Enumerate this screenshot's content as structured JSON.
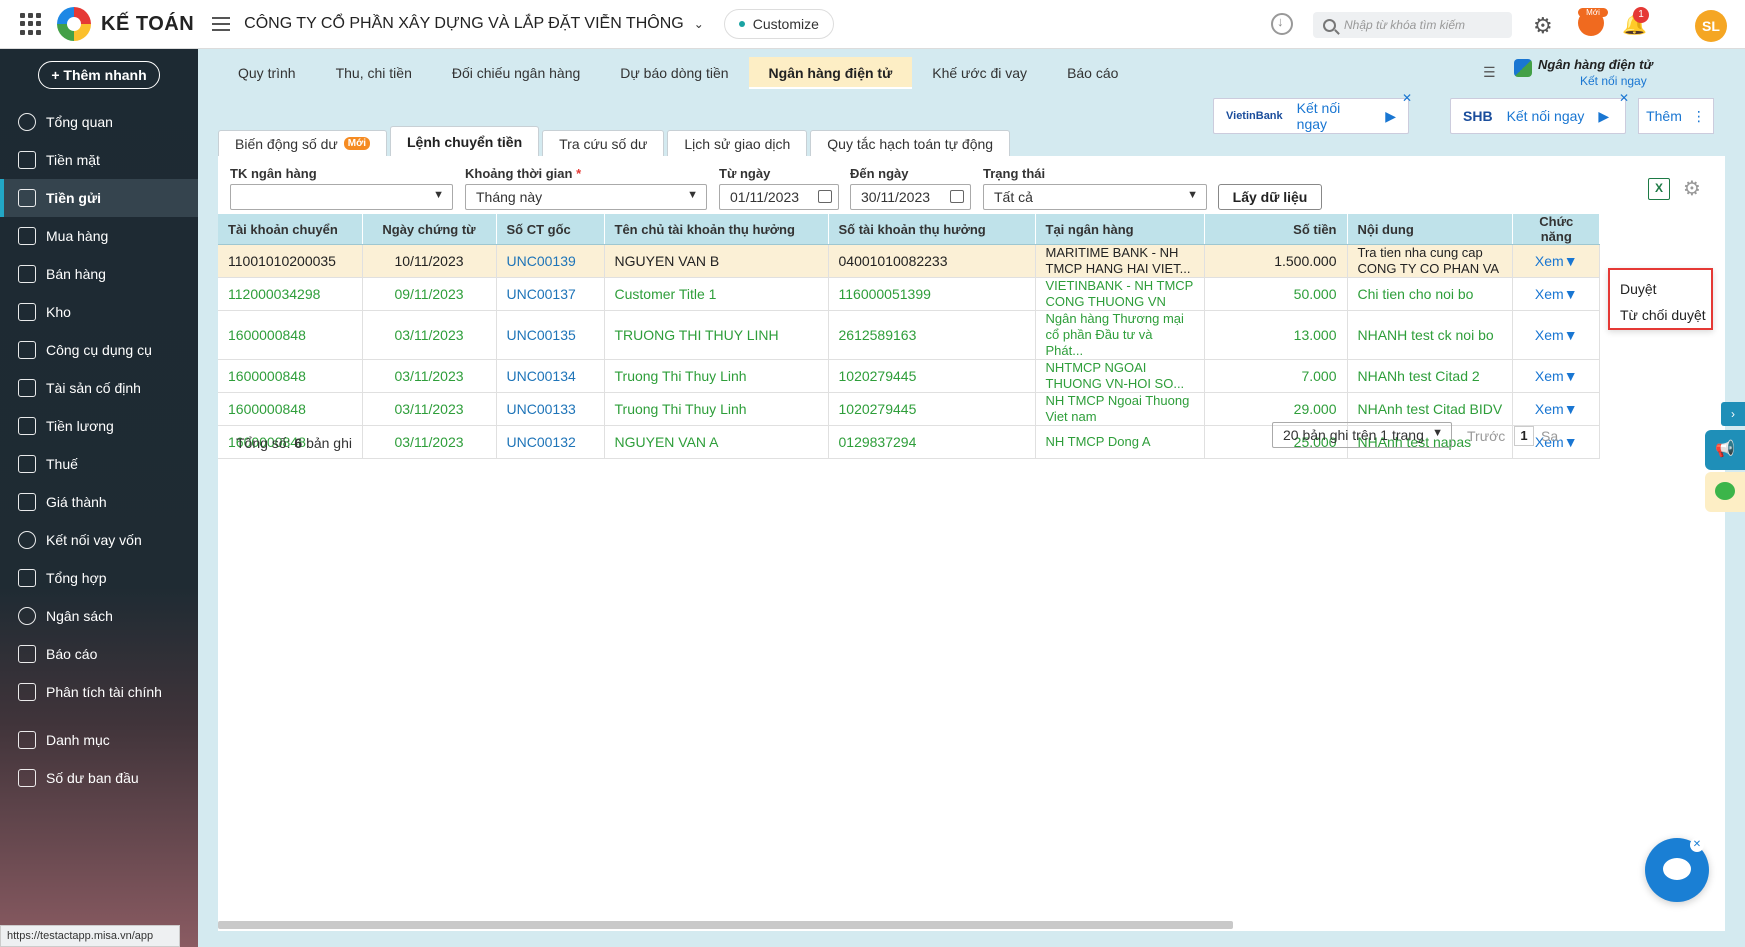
{
  "header": {
    "brand": "KẾ TOÁN",
    "company": "CÔNG TY CỔ PHẦN XÂY DỰNG VÀ LẮP ĐẶT VIỄN THÔNG",
    "customize": "Customize",
    "search_placeholder": "Nhập từ khóa tìm kiếm",
    "new_badge": "Mới",
    "notif_count": "1",
    "avatar": "SL"
  },
  "sidebar": {
    "add_button": "+ Thêm nhanh",
    "items": [
      {
        "label": "Tổng quan",
        "icon": "dashboard-icon"
      },
      {
        "label": "Tiền mặt",
        "icon": "cash-icon"
      },
      {
        "label": "Tiền gửi",
        "icon": "bank-deposit-icon",
        "active": true
      },
      {
        "label": "Mua hàng",
        "icon": "shopping-bag-icon"
      },
      {
        "label": "Bán hàng",
        "icon": "cart-icon"
      },
      {
        "label": "Kho",
        "icon": "warehouse-icon"
      },
      {
        "label": "Công cụ dụng cụ",
        "icon": "tools-icon"
      },
      {
        "label": "Tài sản cố định",
        "icon": "asset-icon"
      },
      {
        "label": "Tiền lương",
        "icon": "salary-icon"
      },
      {
        "label": "Thuế",
        "icon": "tax-icon"
      },
      {
        "label": "Giá thành",
        "icon": "price-tag-icon"
      },
      {
        "label": "Kết nối vay vốn",
        "icon": "loan-icon"
      },
      {
        "label": "Tổng hợp",
        "icon": "summary-icon"
      },
      {
        "label": "Ngân sách",
        "icon": "budget-icon"
      },
      {
        "label": "Báo cáo",
        "icon": "report-icon"
      },
      {
        "label": "Phân tích tài chính",
        "icon": "analytics-icon"
      },
      {
        "label": "Danh mục",
        "icon": "list-icon"
      },
      {
        "label": "Số dư ban đầu",
        "icon": "opening-balance-icon"
      }
    ],
    "status_url": "https://testactapp.misa.vn/app"
  },
  "main_tabs": [
    "Quy trình",
    "Thu, chi tiền",
    "Đối chiếu ngân hàng",
    "Dự báo dòng tiền",
    "Ngân hàng điện tử",
    "Khế ước đi vay",
    "Báo cáo"
  ],
  "ebank": {
    "title": "Ngân hàng điện tử",
    "link": "Kết nối ngay"
  },
  "bank_cards": [
    {
      "name": "VietinBank",
      "action": "Kết nối ngay"
    },
    {
      "name": "SHB",
      "action": "Kết nối ngay"
    }
  ],
  "more_label": "Thêm",
  "sub_tabs": [
    {
      "label": "Biến động số dư",
      "badge": "Mới"
    },
    {
      "label": "Lệnh chuyển tiền",
      "active": true
    },
    {
      "label": "Tra cứu số dư"
    },
    {
      "label": "Lịch sử giao dịch"
    },
    {
      "label": "Quy tắc hạch toán tự động"
    }
  ],
  "filters": {
    "account_label": "TK ngân hàng",
    "account_value": "",
    "period_label": "Khoảng thời gian",
    "period_value": "Tháng này",
    "from_label": "Từ ngày",
    "from_value": "01/11/2023",
    "to_label": "Đến ngày",
    "to_value": "30/11/2023",
    "status_label": "Trạng thái",
    "status_value": "Tất cả",
    "get_button": "Lấy dữ liệu"
  },
  "table": {
    "columns": [
      "Tài khoản chuyển",
      "Ngày chứng từ",
      "Số CT gốc",
      "Tên chủ tài khoản thụ hưởng",
      "Số tài khoản thụ hưởng",
      "Tại ngân hàng",
      "Số tiền",
      "Nội dung",
      "Chức năng"
    ],
    "rows": [
      {
        "from": "11001010200035",
        "date": "10/11/2023",
        "ref": "UNC00139",
        "name": "NGUYEN VAN B",
        "to": "04001010082233",
        "bank": "MARITIME BANK - NH TMCP HANG HAI VIET...",
        "amount": "1.500.000",
        "content": "Tra tien nha cung cap CONG TY CO PHAN VA",
        "action": "Xem",
        "selected": true
      },
      {
        "from": "112000034298",
        "date": "09/11/2023",
        "ref": "UNC00137",
        "name": "Customer Title 1",
        "to": "116000051399",
        "bank": "VIETINBANK - NH TMCP CONG THUONG VN",
        "amount": "50.000",
        "content": "Chi tien cho noi bo",
        "action": "Xem"
      },
      {
        "from": "1600000848",
        "date": "03/11/2023",
        "ref": "UNC00135",
        "name": "TRUONG THI THUY LINH",
        "to": "2612589163",
        "bank": "Ngân hàng Thương mại cổ phần Đầu tư và Phát...",
        "amount": "13.000",
        "content": "NHANH test ck noi bo",
        "action": "Xem"
      },
      {
        "from": "1600000848",
        "date": "03/11/2023",
        "ref": "UNC00134",
        "name": "Truong Thi Thuy Linh",
        "to": "1020279445",
        "bank": "NHTMCP NGOAI THUONG VN-HOI SO...",
        "amount": "7.000",
        "content": "NHANh test Citad 2",
        "action": "Xem"
      },
      {
        "from": "1600000848",
        "date": "03/11/2023",
        "ref": "UNC00133",
        "name": "Truong Thi Thuy Linh",
        "to": "1020279445",
        "bank": "NH TMCP Ngoai Thuong Viet nam",
        "amount": "29.000",
        "content": "NHAnh test Citad BIDV",
        "action": "Xem"
      },
      {
        "from": "1600000848",
        "date": "03/11/2023",
        "ref": "UNC00132",
        "name": "NGUYEN VAN A",
        "to": "0129837294",
        "bank": "NH TMCP Dong A",
        "amount": "25.000",
        "content": "NHAnh test napas",
        "action": "Xem"
      }
    ]
  },
  "summary_label": "Tổng số:",
  "summary_count": "6",
  "summary_suffix": "bản ghi",
  "pager": {
    "per_page": "20 bản ghi trên 1 trang",
    "prev": "Trước",
    "page": "1",
    "next": "Sa"
  },
  "dropdown": [
    "Duyệt",
    "Từ chối duyệt"
  ]
}
